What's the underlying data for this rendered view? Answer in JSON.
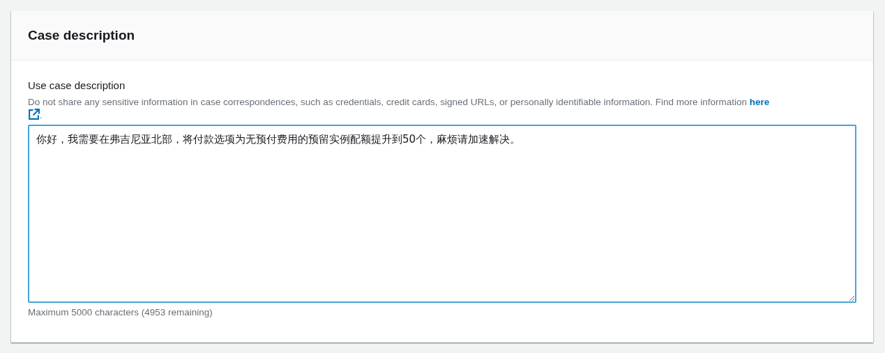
{
  "panel": {
    "title": "Case description"
  },
  "field": {
    "label": "Use case description",
    "hint": "Do not share any sensitive information in case correspondences, such as credentials, credit cards, signed URLs, or personally identifiable information. Find more information",
    "hint_link": "here",
    "hint_end": ".",
    "value": "你好，我需要在弗吉尼亚北部，将付款选项为无预付费用的预留实例配额提升到50个，麻烦请加速解决。",
    "focused": true,
    "constraint": "Maximum 5000 characters (4953 remaining)"
  }
}
